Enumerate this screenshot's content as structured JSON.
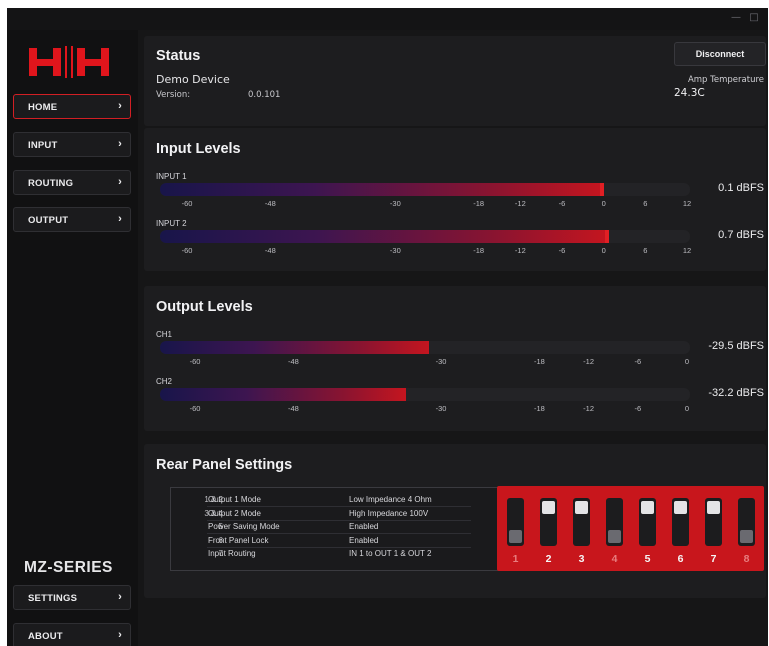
{
  "window": {
    "minimize_glyph": "—",
    "maximize_glyph": "□"
  },
  "sidebar": {
    "logo_alt": "HH",
    "items": [
      {
        "label": "HOME",
        "active": true
      },
      {
        "label": "INPUT",
        "active": false
      },
      {
        "label": "ROUTING",
        "active": false
      },
      {
        "label": "OUTPUT",
        "active": false
      }
    ],
    "series": "MZ-SERIES",
    "bottom_items": [
      {
        "label": "SETTINGS"
      },
      {
        "label": "ABOUT"
      }
    ],
    "chevron": "›"
  },
  "status": {
    "title": "Status",
    "device_name": "Demo Device",
    "version_label": "Version:",
    "version_value": "0.0.101",
    "disconnect_label": "Disconnect",
    "temp_label": "Amp Temperature",
    "temp_value": "24.3C"
  },
  "input_levels": {
    "title": "Input Levels",
    "scale_min": -60,
    "scale_max": 12,
    "ticks": [
      "-60",
      "-48",
      "-30",
      "-18",
      "-12",
      "-6",
      "0",
      "6",
      "12"
    ],
    "tick_values": [
      -60,
      -48,
      -30,
      -18,
      -12,
      -6,
      0,
      6,
      12
    ],
    "meters": [
      {
        "label": "INPUT 1",
        "level_dbfs": 0.1,
        "value": "0.1 dBFS"
      },
      {
        "label": "INPUT 2",
        "level_dbfs": 0.7,
        "value": "0.7 dBFS"
      }
    ]
  },
  "output_levels": {
    "title": "Output Levels",
    "scale_min": -60,
    "scale_max": 0,
    "ticks": [
      "-60",
      "-48",
      "-30",
      "-18",
      "-12",
      "-6",
      "0"
    ],
    "tick_values": [
      -60,
      -48,
      -30,
      -18,
      -12,
      -6,
      0
    ],
    "meters": [
      {
        "label": "CH1",
        "level_dbfs": -29.5,
        "value": "-29.5 dBFS"
      },
      {
        "label": "CH2",
        "level_dbfs": -32.2,
        "value": "-32.2 dBFS"
      }
    ]
  },
  "rear_panel": {
    "title": "Rear Panel Settings",
    "rows": [
      {
        "switches": "1 & 2",
        "name": "Output 1 Mode",
        "value": "Low Impedance 4 Ohm"
      },
      {
        "switches": "3 & 4",
        "name": "Output 2 Mode",
        "value": "High Impedance 100V"
      },
      {
        "switches": "5",
        "name": "Power Saving Mode",
        "value": "Enabled"
      },
      {
        "switches": "6",
        "name": "Front Panel Lock",
        "value": "Enabled"
      },
      {
        "switches": "7",
        "name": "Input Routing",
        "value": "IN 1 to OUT 1 & OUT 2"
      }
    ],
    "dip_switches": [
      {
        "number": "1",
        "on": false
      },
      {
        "number": "2",
        "on": true
      },
      {
        "number": "3",
        "on": true
      },
      {
        "number": "4",
        "on": false
      },
      {
        "number": "5",
        "on": true
      },
      {
        "number": "6",
        "on": true
      },
      {
        "number": "7",
        "on": true
      },
      {
        "number": "8",
        "on": false
      }
    ]
  },
  "colors": {
    "accent_red": "#d21f24",
    "background": "#161617",
    "card": "#1d1d1f",
    "meter_start": "#18154a",
    "meter_end": "#c4151f"
  }
}
